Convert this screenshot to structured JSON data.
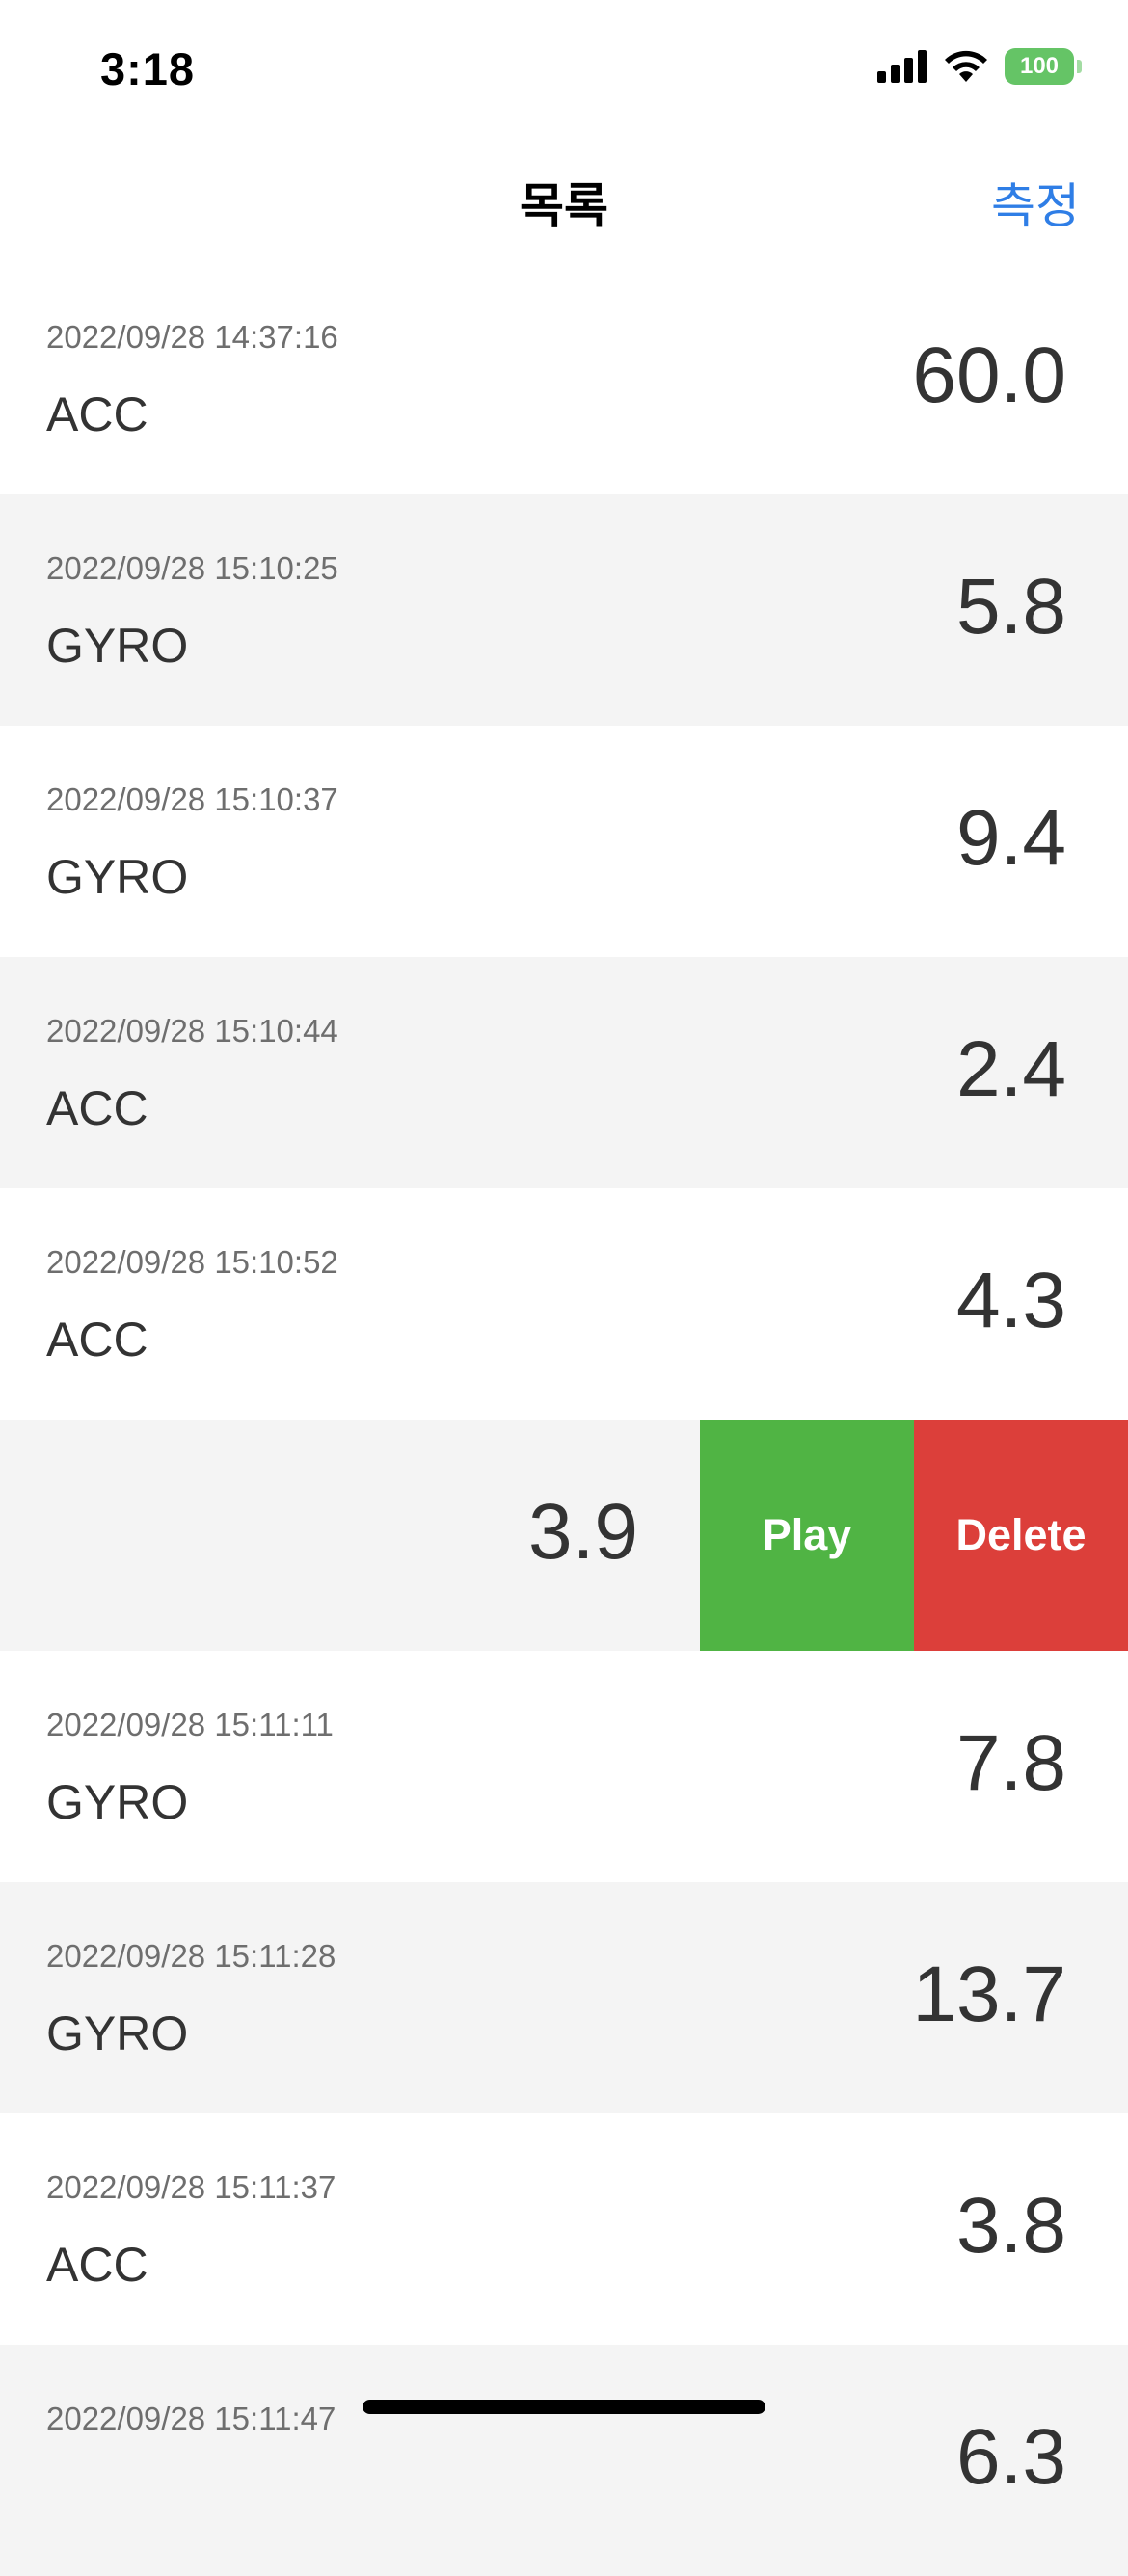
{
  "status_bar": {
    "time": "3:18",
    "battery": "100"
  },
  "nav": {
    "title": "목록",
    "action": "측정"
  },
  "rows": [
    {
      "date": "2022/09/28 14:37:16",
      "type": "ACC",
      "value": "60.0"
    },
    {
      "date": "2022/09/28 15:10:25",
      "type": "GYRO",
      "value": "5.8"
    },
    {
      "date": "2022/09/28 15:10:37",
      "type": "GYRO",
      "value": "9.4"
    },
    {
      "date": "2022/09/28 15:10:44",
      "type": "ACC",
      "value": "2.4"
    },
    {
      "date": "2022/09/28 15:10:52",
      "type": "ACC",
      "value": "4.3"
    },
    {
      "value": "3.9",
      "actions": {
        "play": "Play",
        "delete": "Delete"
      }
    },
    {
      "date": "2022/09/28 15:11:11",
      "type": "GYRO",
      "value": "7.8"
    },
    {
      "date": "2022/09/28 15:11:28",
      "type": "GYRO",
      "value": "13.7"
    },
    {
      "date": "2022/09/28 15:11:37",
      "type": "ACC",
      "value": "3.8"
    },
    {
      "date": "2022/09/28 15:11:47",
      "type": "",
      "value": "6.3"
    }
  ]
}
